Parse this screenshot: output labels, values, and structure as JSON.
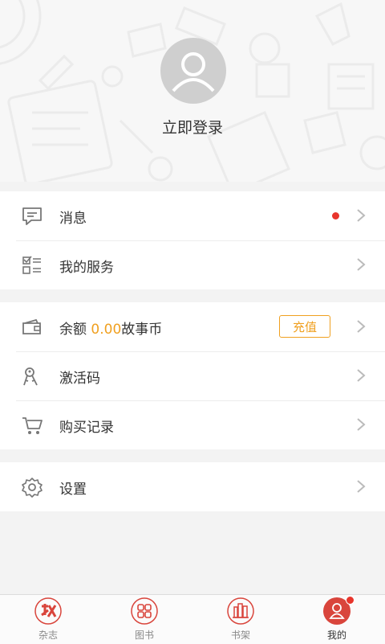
{
  "profile": {
    "login_text": "立即登录"
  },
  "menu": {
    "messages": {
      "label": "消息",
      "has_unread": true
    },
    "services": {
      "label": "我的服务"
    },
    "balance": {
      "label_prefix": "余额 ",
      "amount": "0.00",
      "unit": "故事币",
      "recharge": "充值"
    },
    "activation": {
      "label": "激活码"
    },
    "purchases": {
      "label": "购买记录"
    },
    "settings": {
      "label": "设置"
    }
  },
  "tabs": [
    {
      "label": "杂志",
      "icon": "magazine-icon",
      "active": false
    },
    {
      "label": "图书",
      "icon": "books-icon",
      "active": false
    },
    {
      "label": "书架",
      "icon": "bookshelf-icon",
      "active": false
    },
    {
      "label": "我的",
      "icon": "profile-icon",
      "active": true,
      "badge": true
    }
  ],
  "colors": {
    "accent": "#e8352c",
    "amount": "#f0a020",
    "background": "#f3f3f3"
  }
}
